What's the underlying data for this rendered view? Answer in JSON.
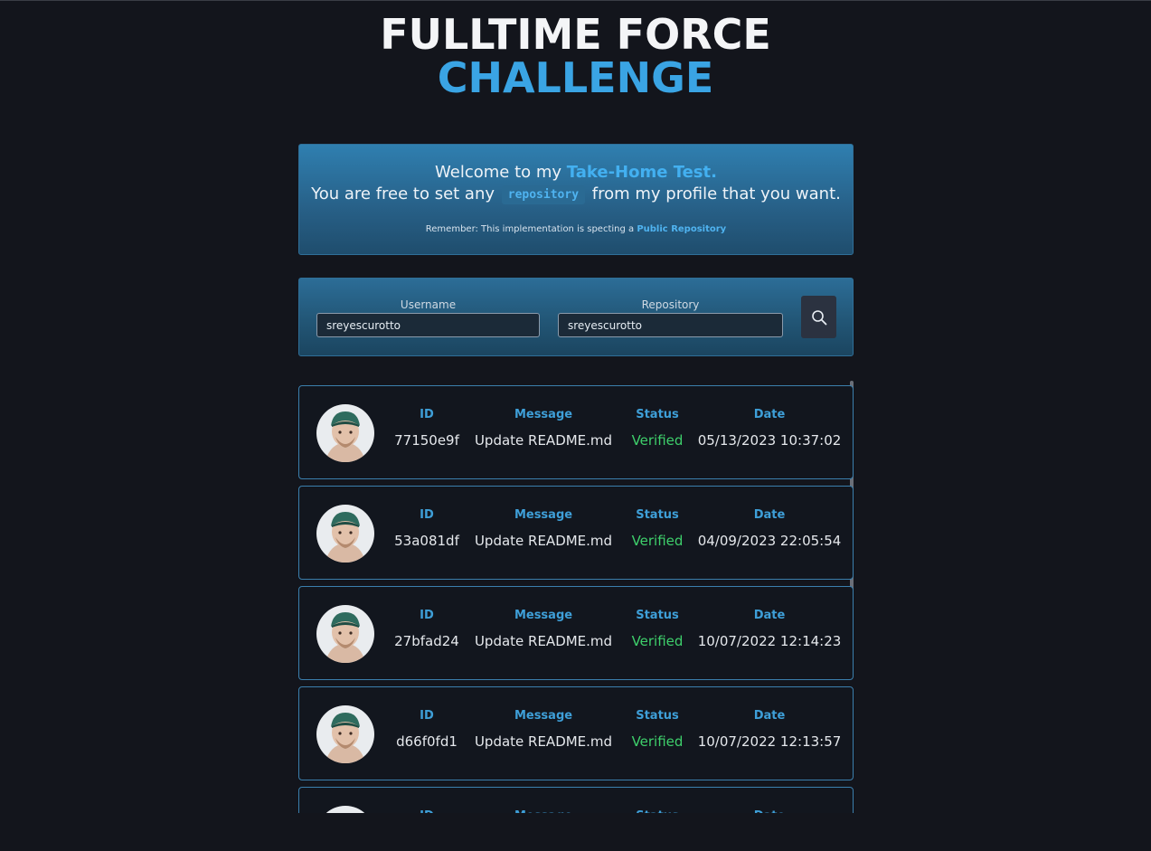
{
  "header": {
    "title_line1": "FULLTIME FORCE",
    "title_line2": "CHALLENGE"
  },
  "welcome": {
    "line1_prefix": "Welcome to my ",
    "line1_accent": "Take-Home Test.",
    "line2_prefix": "You are free to set any",
    "line2_code": "repository",
    "line2_suffix": "from my profile that you want.",
    "note_prefix": "Remember: This implementation is specting a ",
    "note_link": "Public Repository"
  },
  "search": {
    "username_label": "Username",
    "username_value": "sreyescurotto",
    "repository_label": "Repository",
    "repository_value": "sreyescurotto",
    "button_icon": "search-icon"
  },
  "columns": {
    "id": "ID",
    "message": "Message",
    "status": "Status",
    "date": "Date"
  },
  "commits": [
    {
      "id": "77150e9f",
      "message": "Update README.md",
      "status": "Verified",
      "date": "05/13/2023 10:37:02"
    },
    {
      "id": "53a081df",
      "message": "Update README.md",
      "status": "Verified",
      "date": "04/09/2023 22:05:54"
    },
    {
      "id": "27bfad24",
      "message": "Update README.md",
      "status": "Verified",
      "date": "10/07/2022 12:14:23"
    },
    {
      "id": "d66f0fd1",
      "message": "Update README.md",
      "status": "Verified",
      "date": "10/07/2022 12:13:57"
    },
    {
      "id": "",
      "message": "",
      "status": "",
      "date": ""
    }
  ],
  "colors": {
    "accent": "#3aa4e4",
    "verified": "#3ecf6b",
    "background": "#13151c"
  }
}
